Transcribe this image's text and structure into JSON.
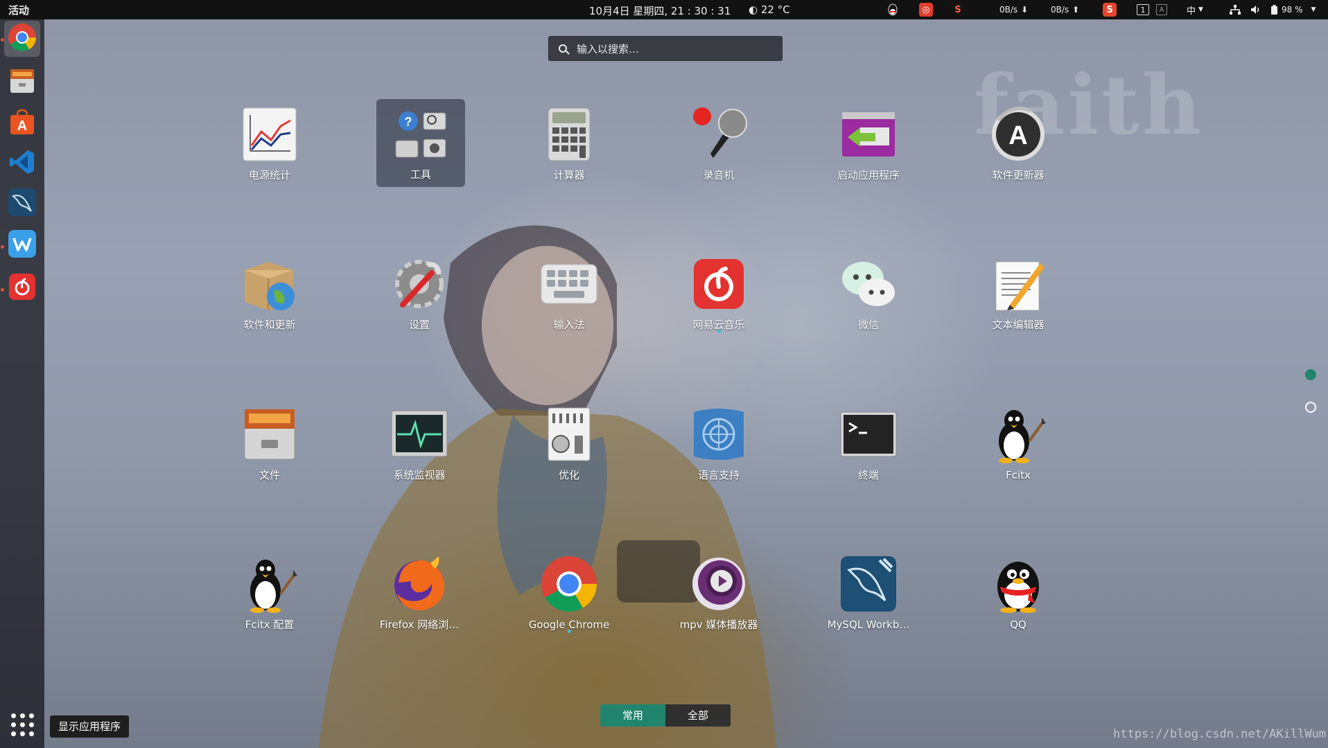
{
  "topbar": {
    "activities": "活动",
    "clock": "10月4日 星期四, 21 : 30 : 31",
    "weather": "22 °C",
    "net_down": "0B/s",
    "net_up": "0B/s",
    "input_method": "中",
    "keyboard_indicator": "1",
    "battery": "98 %"
  },
  "search": {
    "placeholder": "输入以搜索…"
  },
  "dock": {
    "items": [
      {
        "name": "google-chrome",
        "active": true,
        "running": true
      },
      {
        "name": "files",
        "running": false
      },
      {
        "name": "software-center",
        "running": false
      },
      {
        "name": "vscode",
        "running": false
      },
      {
        "name": "mysql-workbench",
        "running": false
      },
      {
        "name": "wps",
        "running": true
      },
      {
        "name": "netease-music",
        "running": true
      }
    ],
    "show_apps_tooltip": "显示应用程序"
  },
  "apps": [
    {
      "label": "电源统计",
      "icon": "chart-icon"
    },
    {
      "label": "工具",
      "icon": "tools-folder-icon",
      "selected": true
    },
    {
      "label": "计算器",
      "icon": "calculator-icon"
    },
    {
      "label": "录音机",
      "icon": "microphone-icon"
    },
    {
      "label": "启动应用程序",
      "icon": "startup-apps-icon"
    },
    {
      "label": "软件更新器",
      "icon": "update-icon"
    },
    {
      "label": "软件和更新",
      "icon": "software-updates-icon"
    },
    {
      "label": "设置",
      "icon": "settings-icon"
    },
    {
      "label": "输入法",
      "icon": "keyboard-icon"
    },
    {
      "label": "网易云音乐",
      "icon": "netease-music-icon",
      "running": true
    },
    {
      "label": "微信",
      "icon": "wechat-icon"
    },
    {
      "label": "文本编辑器",
      "icon": "text-editor-icon"
    },
    {
      "label": "文件",
      "icon": "file-cabinet-icon"
    },
    {
      "label": "系统监视器",
      "icon": "system-monitor-icon"
    },
    {
      "label": "优化",
      "icon": "tweaks-icon"
    },
    {
      "label": "语言支持",
      "icon": "language-icon"
    },
    {
      "label": "终端",
      "icon": "terminal-icon"
    },
    {
      "label": "Fcitx",
      "icon": "penguin-icon"
    },
    {
      "label": "Fcitx 配置",
      "icon": "penguin-config-icon"
    },
    {
      "label": "Firefox 网络浏…",
      "icon": "firefox-icon"
    },
    {
      "label": "Google Chrome",
      "icon": "chrome-icon",
      "running": true
    },
    {
      "label": "mpv 媒体播放器",
      "icon": "mpv-icon"
    },
    {
      "label": "MySQL Workb…",
      "icon": "mysql-icon"
    },
    {
      "label": "QQ",
      "icon": "qq-icon"
    }
  ],
  "pages": {
    "current": 1,
    "total": 2
  },
  "tabs": {
    "frequent": "常用",
    "all": "全部"
  },
  "wallpaper": {
    "watermark": "faith",
    "url": "https://blog.csdn.net/AKillWum"
  },
  "colors": {
    "accent": "#21856e",
    "topbar": "#121212",
    "running_dot": "#4fb8d8"
  }
}
